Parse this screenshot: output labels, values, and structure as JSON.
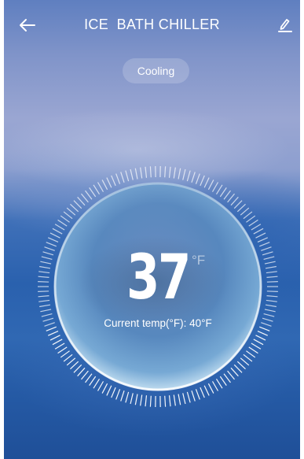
{
  "header": {
    "title": "ICE  BATH CHILLER",
    "back_icon": "arrow-left-icon",
    "edit_icon": "pencil-icon"
  },
  "mode": {
    "label": "Cooling"
  },
  "thermostat": {
    "setpoint": "37",
    "unit": "°F",
    "current_temp_text": "Current temp(°F): 40°F"
  },
  "colors": {
    "text": "#ffffff",
    "accent_blue": "#2a61ae"
  }
}
